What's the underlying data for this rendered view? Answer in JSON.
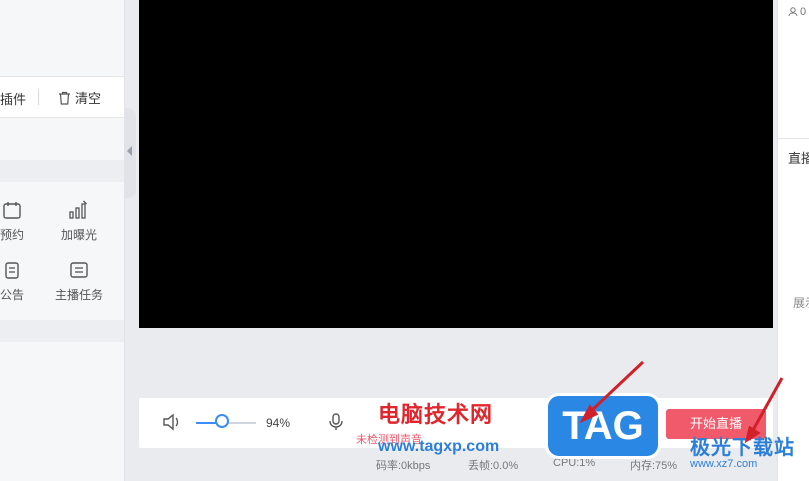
{
  "toolbar": {
    "plugin_label": "插件",
    "clear_label": "清空"
  },
  "tools": {
    "reserve": "预约",
    "boost": "加曝光",
    "notice": "公告",
    "host_task": "主播任务"
  },
  "controls": {
    "volume_pct": "94%",
    "volume_value": 0.94,
    "mic_warning": "未检测到声音",
    "start_button": "开始直播"
  },
  "stats": {
    "bitrate": "码率:0kbps",
    "drop_frames": "丢帧:0.0%",
    "cpu": "CPU:1%",
    "memory": "内存:75%"
  },
  "right_panel": {
    "viewer_count": "0",
    "live_title": "直播",
    "show_label": "展示"
  },
  "watermark": {
    "site_name": "电脑技术网",
    "site_url": "www.tagxp.com",
    "tag": "TAG",
    "jg_name": "极光下载站",
    "jg_url": "www.xz7.com"
  },
  "colors": {
    "accent": "#3b8cf5",
    "start": "#f05a6b",
    "video_bg": "#000000"
  }
}
